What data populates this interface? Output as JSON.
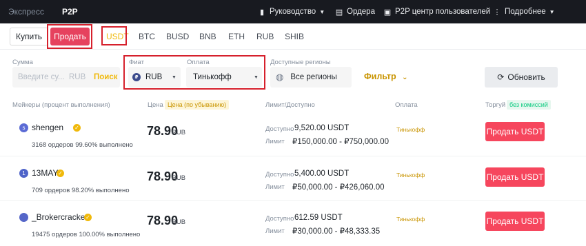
{
  "topnav": {
    "express": "Экспресс",
    "p2p": "P2P",
    "guide": "Руководство",
    "orders": "Ордера",
    "user_center": "P2P центр пользователей",
    "more": "Подробнее"
  },
  "trade_toggle": {
    "buy": "Купить",
    "sell": "Продать"
  },
  "coins": [
    "USDT",
    "BTC",
    "BUSD",
    "BNB",
    "ETH",
    "RUB",
    "SHIB"
  ],
  "filters": {
    "amount_label": "Сумма",
    "amount_placeholder": "Введите су...",
    "amount_currency": "RUB",
    "search": "Поиск",
    "fiat_label": "Фиат",
    "fiat_value": "RUB",
    "fiat_icon_letter": "₽",
    "payment_label": "Оплата",
    "payment_value": "Тинькофф",
    "regions_label": "Доступные регионы",
    "regions_value": "Все регионы",
    "filter": "Фильтр",
    "refresh": "Обновить"
  },
  "table_header": {
    "makers": "Мейкеры (процент выполнения)",
    "price": "Цена",
    "price_sort": "Цена (по убыванию)",
    "limit": "Лимит/Доступно",
    "payment": "Оплата",
    "trade": "Торгуй",
    "no_fee": "без комиссий"
  },
  "rows": [
    {
      "initial": "s",
      "avatar_color": "#5b6bd5",
      "name": "shengen",
      "stats": "3168 ордеров   99.60% выполнено",
      "price": "78.90",
      "currency": "RUB",
      "available_label": "Доступно",
      "available": "9,520.00 USDT",
      "limit_label": "Лимит",
      "limit": "₽150,000.00 - ₽750,000.00",
      "payment": "Тинькофф",
      "action": "Продать USDT"
    },
    {
      "initial": "1",
      "avatar_color": "#4f64c9",
      "name": "13MAY",
      "stats": "709 ордеров   98.20% выполнено",
      "price": "78.90",
      "currency": "RUB",
      "available_label": "Доступно",
      "available": "5,400.00 USDT",
      "limit_label": "Лимит",
      "limit": "₽50,000.00 - ₽426,060.00",
      "payment": "Тинькофф",
      "action": "Продать USDT"
    },
    {
      "initial": "",
      "avatar_color": "#5566c8",
      "name": "_Brokercracker",
      "stats": "19475 ордеров   100.00% выполнено",
      "price": "78.90",
      "currency": "RUB",
      "available_label": "Доступно",
      "available": "612.59 USDT",
      "limit_label": "Лимит",
      "limit": "₽30,000.00 - ₽48,333.35",
      "payment": "Тинькофф",
      "action": "Продать USDT"
    }
  ]
}
